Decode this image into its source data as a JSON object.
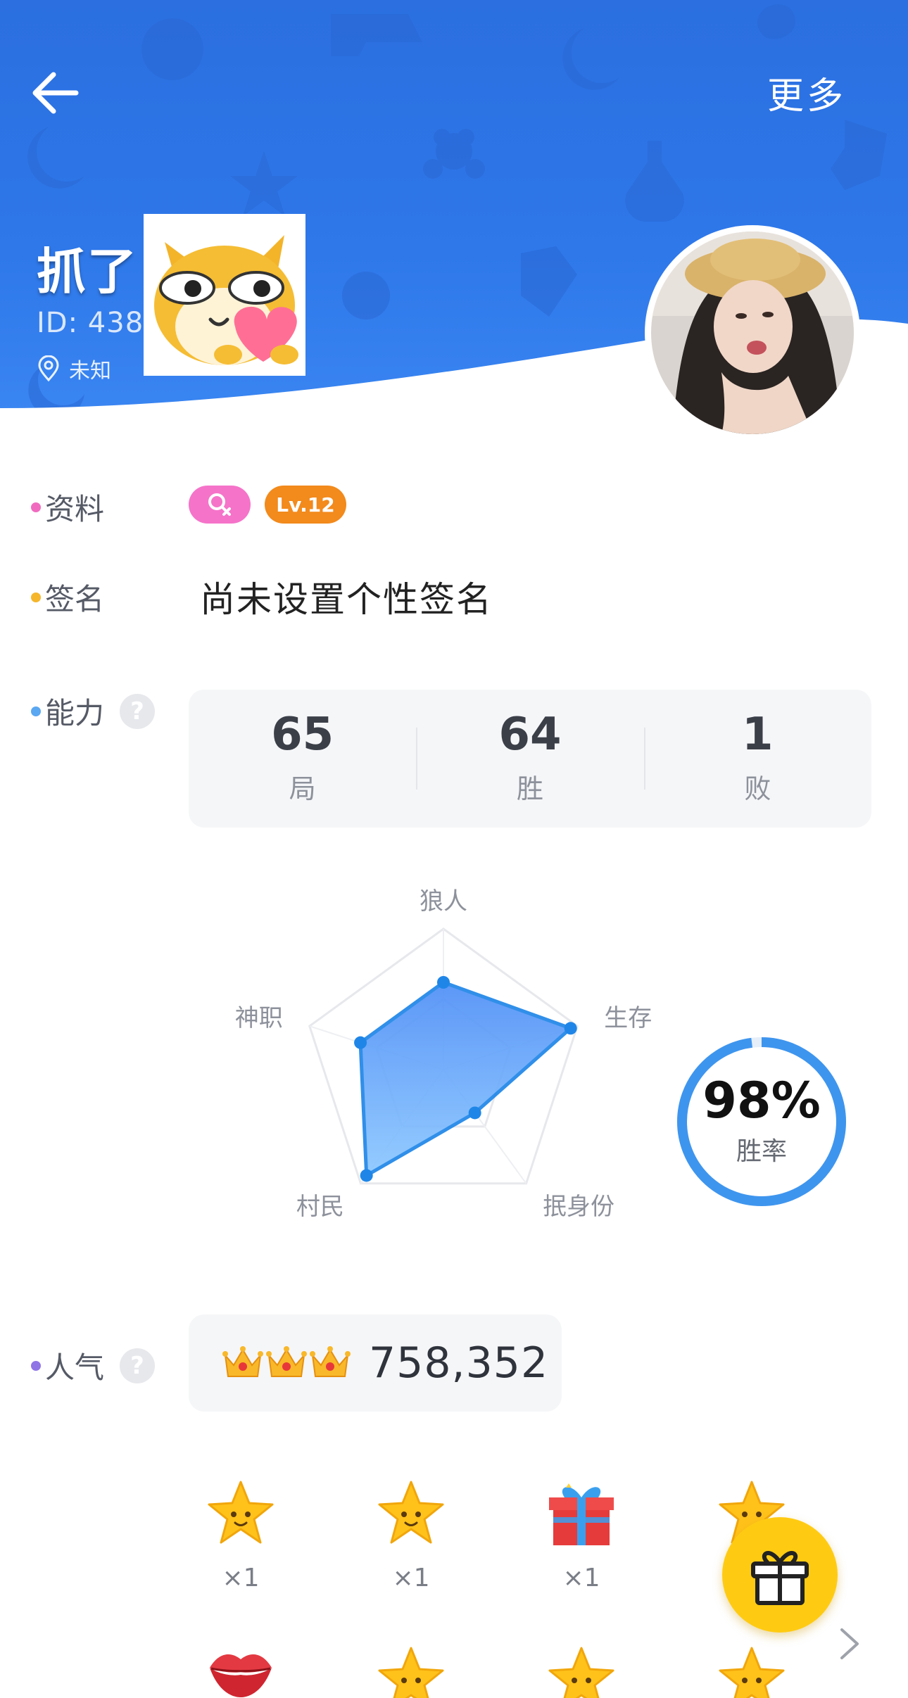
{
  "header": {
    "more_label": "更多",
    "nickname": "抓了",
    "user_id": "ID: 438",
    "location": "未知"
  },
  "profile": {
    "label": "资料",
    "level": "Lv.12",
    "colors": {
      "gender_badge": "#f573c9",
      "level_badge": "#f28a1c"
    }
  },
  "signature": {
    "label": "签名",
    "text": "尚未设置个性签名"
  },
  "ability": {
    "label": "能力",
    "help": "?",
    "stats": [
      {
        "value": "65",
        "label": "局"
      },
      {
        "value": "64",
        "label": "胜"
      },
      {
        "value": "1",
        "label": "败"
      }
    ],
    "radar_axes": [
      "狼人",
      "生存",
      "抿身份",
      "村民",
      "神职"
    ],
    "radar_values": [
      0.62,
      0.95,
      0.38,
      0.93,
      0.62
    ],
    "win_rate": "98%",
    "win_rate_fraction": 0.98,
    "win_rate_label": "胜率"
  },
  "popularity": {
    "label": "人气",
    "help": "?",
    "value": "758,352",
    "crown_count": 3
  },
  "gifts": [
    {
      "icon": "star-gift-icon",
      "count": "×1"
    },
    {
      "icon": "star-gift-icon",
      "count": "×1"
    },
    {
      "icon": "gift-box-icon",
      "count": "×1"
    },
    {
      "icon": "star-gift-icon",
      "count": ""
    },
    {
      "icon": "lips-gift-icon",
      "count": ""
    },
    {
      "icon": "star-gift-icon",
      "count": ""
    },
    {
      "icon": "star-gift-icon",
      "count": ""
    },
    {
      "icon": "star-gift-icon",
      "count": ""
    }
  ],
  "colors": {
    "primary_blue": "#2e78ea",
    "radar_fill": "#3d8ef5",
    "dot_profile": "#f06bbf",
    "dot_signature": "#f5b62c",
    "dot_ability": "#5aa7f2",
    "dot_popularity": "#8f74e6"
  }
}
